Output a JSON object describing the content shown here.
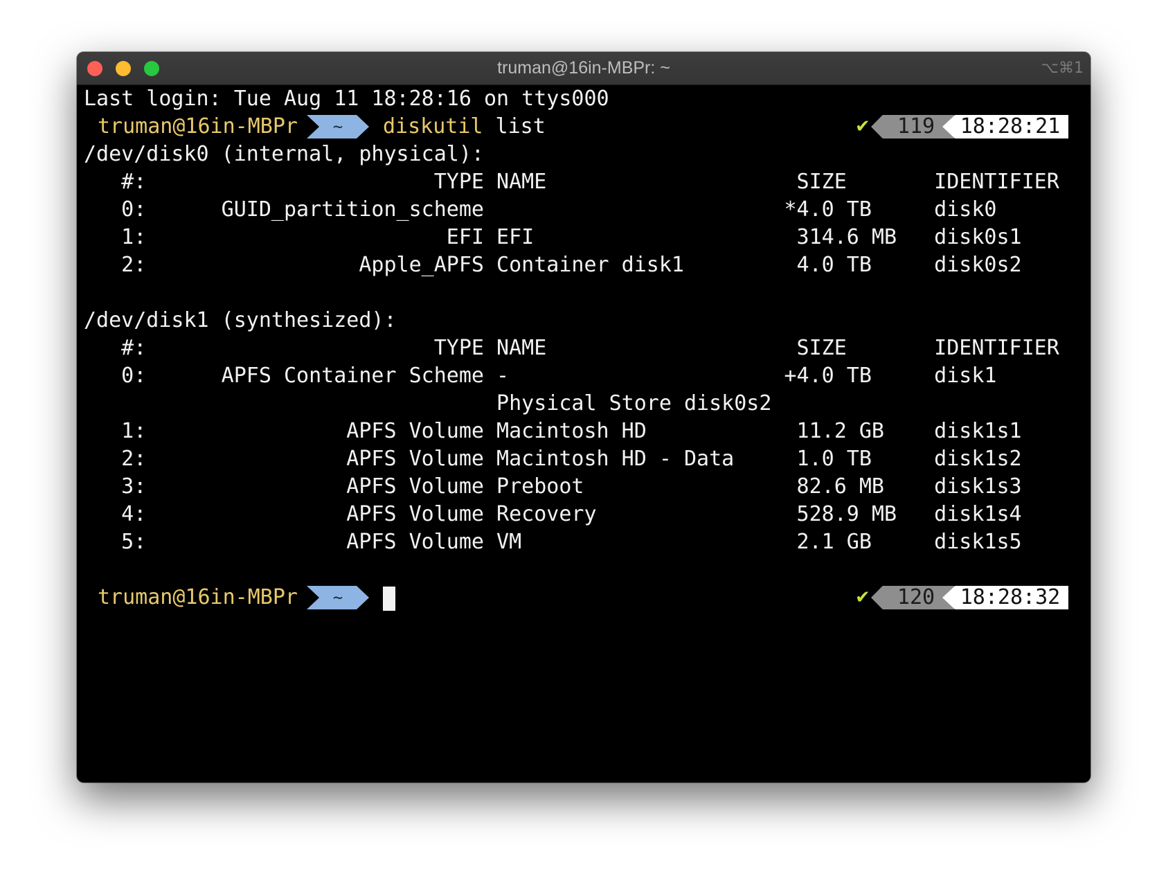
{
  "window": {
    "title": "truman@16in-MBPr: ~",
    "shortcut": "⌥⌘1"
  },
  "terminal": {
    "last_login": "Last login: Tue Aug 11 18:28:16 on ttys000",
    "prompt1": {
      "user": "truman@16in-MBPr",
      "dir": "~",
      "cmd_program": "diskutil",
      "cmd_args": " list",
      "status_icon": "✔",
      "history_num": "119",
      "time": "18:28:21"
    },
    "output_lines": [
      "/dev/disk0 (internal, physical):",
      "   #:                       TYPE NAME                    SIZE       IDENTIFIER",
      "   0:      GUID_partition_scheme                        *4.0 TB     disk0",
      "   1:                        EFI EFI                     314.6 MB   disk0s1",
      "   2:                 Apple_APFS Container disk1         4.0 TB     disk0s2",
      "",
      "/dev/disk1 (synthesized):",
      "   #:                       TYPE NAME                    SIZE       IDENTIFIER",
      "   0:      APFS Container Scheme -                      +4.0 TB     disk1",
      "                                 Physical Store disk0s2",
      "   1:                APFS Volume Macintosh HD            11.2 GB    disk1s1",
      "   2:                APFS Volume Macintosh HD - Data     1.0 TB     disk1s2",
      "   3:                APFS Volume Preboot                 82.6 MB    disk1s3",
      "   4:                APFS Volume Recovery                528.9 MB   disk1s4",
      "   5:                APFS Volume VM                      2.1 GB     disk1s5",
      ""
    ],
    "prompt2": {
      "user": "truman@16in-MBPr",
      "dir": "~",
      "status_icon": "✔",
      "history_num": "120",
      "time": "18:28:32"
    }
  }
}
